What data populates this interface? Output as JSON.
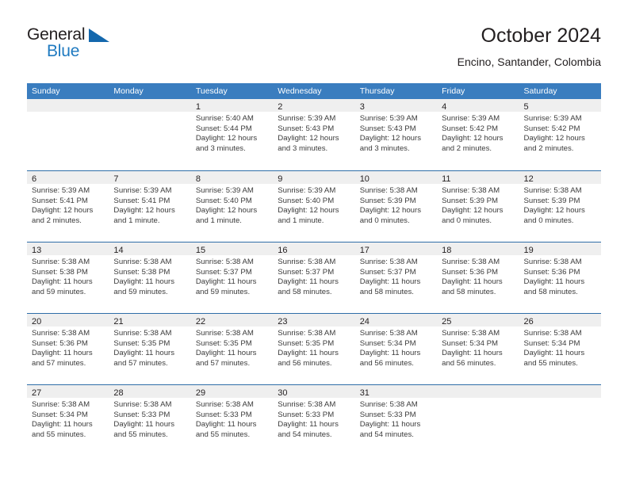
{
  "brand": {
    "name_part1": "General",
    "name_part2": "Blue",
    "triangle_color": "#1468ad"
  },
  "header": {
    "title": "October 2024",
    "subtitle": "Encino, Santander, Colombia"
  },
  "theme": {
    "header_blue": "#3a7dbf",
    "row_rule_blue": "#2f6ea8",
    "datestrip_gray": "#efefef",
    "text_dark": "#231f20"
  },
  "weekdays": [
    "Sunday",
    "Monday",
    "Tuesday",
    "Wednesday",
    "Thursday",
    "Friday",
    "Saturday"
  ],
  "weeks": [
    [
      {
        "empty": true
      },
      {
        "empty": true
      },
      {
        "day": "1",
        "sunrise": "Sunrise: 5:40 AM",
        "sunset": "Sunset: 5:44 PM",
        "daylight1": "Daylight: 12 hours",
        "daylight2": "and 3 minutes."
      },
      {
        "day": "2",
        "sunrise": "Sunrise: 5:39 AM",
        "sunset": "Sunset: 5:43 PM",
        "daylight1": "Daylight: 12 hours",
        "daylight2": "and 3 minutes."
      },
      {
        "day": "3",
        "sunrise": "Sunrise: 5:39 AM",
        "sunset": "Sunset: 5:43 PM",
        "daylight1": "Daylight: 12 hours",
        "daylight2": "and 3 minutes."
      },
      {
        "day": "4",
        "sunrise": "Sunrise: 5:39 AM",
        "sunset": "Sunset: 5:42 PM",
        "daylight1": "Daylight: 12 hours",
        "daylight2": "and 2 minutes."
      },
      {
        "day": "5",
        "sunrise": "Sunrise: 5:39 AM",
        "sunset": "Sunset: 5:42 PM",
        "daylight1": "Daylight: 12 hours",
        "daylight2": "and 2 minutes."
      }
    ],
    [
      {
        "day": "6",
        "sunrise": "Sunrise: 5:39 AM",
        "sunset": "Sunset: 5:41 PM",
        "daylight1": "Daylight: 12 hours",
        "daylight2": "and 2 minutes."
      },
      {
        "day": "7",
        "sunrise": "Sunrise: 5:39 AM",
        "sunset": "Sunset: 5:41 PM",
        "daylight1": "Daylight: 12 hours",
        "daylight2": "and 1 minute."
      },
      {
        "day": "8",
        "sunrise": "Sunrise: 5:39 AM",
        "sunset": "Sunset: 5:40 PM",
        "daylight1": "Daylight: 12 hours",
        "daylight2": "and 1 minute."
      },
      {
        "day": "9",
        "sunrise": "Sunrise: 5:39 AM",
        "sunset": "Sunset: 5:40 PM",
        "daylight1": "Daylight: 12 hours",
        "daylight2": "and 1 minute."
      },
      {
        "day": "10",
        "sunrise": "Sunrise: 5:38 AM",
        "sunset": "Sunset: 5:39 PM",
        "daylight1": "Daylight: 12 hours",
        "daylight2": "and 0 minutes."
      },
      {
        "day": "11",
        "sunrise": "Sunrise: 5:38 AM",
        "sunset": "Sunset: 5:39 PM",
        "daylight1": "Daylight: 12 hours",
        "daylight2": "and 0 minutes."
      },
      {
        "day": "12",
        "sunrise": "Sunrise: 5:38 AM",
        "sunset": "Sunset: 5:39 PM",
        "daylight1": "Daylight: 12 hours",
        "daylight2": "and 0 minutes."
      }
    ],
    [
      {
        "day": "13",
        "sunrise": "Sunrise: 5:38 AM",
        "sunset": "Sunset: 5:38 PM",
        "daylight1": "Daylight: 11 hours",
        "daylight2": "and 59 minutes."
      },
      {
        "day": "14",
        "sunrise": "Sunrise: 5:38 AM",
        "sunset": "Sunset: 5:38 PM",
        "daylight1": "Daylight: 11 hours",
        "daylight2": "and 59 minutes."
      },
      {
        "day": "15",
        "sunrise": "Sunrise: 5:38 AM",
        "sunset": "Sunset: 5:37 PM",
        "daylight1": "Daylight: 11 hours",
        "daylight2": "and 59 minutes."
      },
      {
        "day": "16",
        "sunrise": "Sunrise: 5:38 AM",
        "sunset": "Sunset: 5:37 PM",
        "daylight1": "Daylight: 11 hours",
        "daylight2": "and 58 minutes."
      },
      {
        "day": "17",
        "sunrise": "Sunrise: 5:38 AM",
        "sunset": "Sunset: 5:37 PM",
        "daylight1": "Daylight: 11 hours",
        "daylight2": "and 58 minutes."
      },
      {
        "day": "18",
        "sunrise": "Sunrise: 5:38 AM",
        "sunset": "Sunset: 5:36 PM",
        "daylight1": "Daylight: 11 hours",
        "daylight2": "and 58 minutes."
      },
      {
        "day": "19",
        "sunrise": "Sunrise: 5:38 AM",
        "sunset": "Sunset: 5:36 PM",
        "daylight1": "Daylight: 11 hours",
        "daylight2": "and 58 minutes."
      }
    ],
    [
      {
        "day": "20",
        "sunrise": "Sunrise: 5:38 AM",
        "sunset": "Sunset: 5:36 PM",
        "daylight1": "Daylight: 11 hours",
        "daylight2": "and 57 minutes."
      },
      {
        "day": "21",
        "sunrise": "Sunrise: 5:38 AM",
        "sunset": "Sunset: 5:35 PM",
        "daylight1": "Daylight: 11 hours",
        "daylight2": "and 57 minutes."
      },
      {
        "day": "22",
        "sunrise": "Sunrise: 5:38 AM",
        "sunset": "Sunset: 5:35 PM",
        "daylight1": "Daylight: 11 hours",
        "daylight2": "and 57 minutes."
      },
      {
        "day": "23",
        "sunrise": "Sunrise: 5:38 AM",
        "sunset": "Sunset: 5:35 PM",
        "daylight1": "Daylight: 11 hours",
        "daylight2": "and 56 minutes."
      },
      {
        "day": "24",
        "sunrise": "Sunrise: 5:38 AM",
        "sunset": "Sunset: 5:34 PM",
        "daylight1": "Daylight: 11 hours",
        "daylight2": "and 56 minutes."
      },
      {
        "day": "25",
        "sunrise": "Sunrise: 5:38 AM",
        "sunset": "Sunset: 5:34 PM",
        "daylight1": "Daylight: 11 hours",
        "daylight2": "and 56 minutes."
      },
      {
        "day": "26",
        "sunrise": "Sunrise: 5:38 AM",
        "sunset": "Sunset: 5:34 PM",
        "daylight1": "Daylight: 11 hours",
        "daylight2": "and 55 minutes."
      }
    ],
    [
      {
        "day": "27",
        "sunrise": "Sunrise: 5:38 AM",
        "sunset": "Sunset: 5:34 PM",
        "daylight1": "Daylight: 11 hours",
        "daylight2": "and 55 minutes."
      },
      {
        "day": "28",
        "sunrise": "Sunrise: 5:38 AM",
        "sunset": "Sunset: 5:33 PM",
        "daylight1": "Daylight: 11 hours",
        "daylight2": "and 55 minutes."
      },
      {
        "day": "29",
        "sunrise": "Sunrise: 5:38 AM",
        "sunset": "Sunset: 5:33 PM",
        "daylight1": "Daylight: 11 hours",
        "daylight2": "and 55 minutes."
      },
      {
        "day": "30",
        "sunrise": "Sunrise: 5:38 AM",
        "sunset": "Sunset: 5:33 PM",
        "daylight1": "Daylight: 11 hours",
        "daylight2": "and 54 minutes."
      },
      {
        "day": "31",
        "sunrise": "Sunrise: 5:38 AM",
        "sunset": "Sunset: 5:33 PM",
        "daylight1": "Daylight: 11 hours",
        "daylight2": "and 54 minutes."
      },
      {
        "empty": true
      },
      {
        "empty": true
      }
    ]
  ]
}
